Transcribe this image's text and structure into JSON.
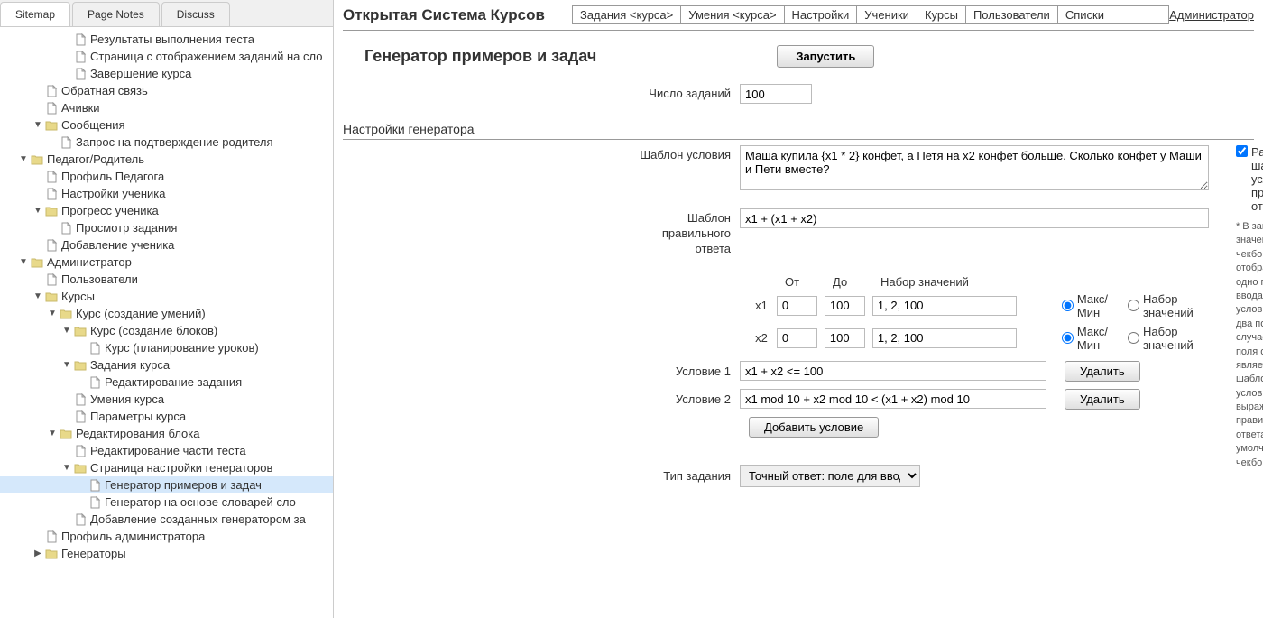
{
  "tabs": {
    "sitemap": "Sitemap",
    "pagenotes": "Page Notes",
    "discuss": "Discuss"
  },
  "tree": {
    "n0": "Результаты выполнения теста",
    "n1": "Страница с отображением заданий на сло",
    "n2": "Завершение курса",
    "n3": "Обратная связь",
    "n4": "Ачивки",
    "n5": "Сообщения",
    "n6": "Запрос на подтверждение родителя",
    "n7": "Педагог/Родитель",
    "n8": "Профиль Педагога",
    "n9": "Настройки ученика",
    "n10": "Прогресс ученика",
    "n11": "Просмотр задания",
    "n12": "Добавление ученика",
    "n13": "Администратор",
    "n14": "Пользователи",
    "n15": "Курсы",
    "n16": "Курс (создание умений)",
    "n17": "Курс (создание блоков)",
    "n18": "Курс (планирование уроков)",
    "n19": "Задания курса",
    "n20": "Редактирование задания",
    "n21": "Умения курса",
    "n22": "Параметры курса",
    "n23": "Редактирования блока",
    "n24": "Редактирование части теста",
    "n25": "Страница настройки генераторов",
    "n26": "Генератор примеров и задач",
    "n27": "Генератор на основе словарей сло",
    "n28": "Добавление созданных генератором за",
    "n29": "Профиль администратора",
    "n30": "Генераторы"
  },
  "header": {
    "app_title": "Открытая Система Курсов",
    "links": [
      "Задания <курса>",
      "Умения <курса>",
      "Настройки",
      "Ученики",
      "Курсы",
      "Пользователи",
      "Списки"
    ],
    "admin": "Администратор"
  },
  "page": {
    "title": "Генератор примеров и задач",
    "run": "Запустить",
    "count_label": "Число заданий",
    "count_value": "100",
    "gen_settings": "Настройки генератора",
    "template_label": "Шаблон условия",
    "template_value": "Маша купила {x1 * 2} конфет, а Петя на x2 конфет больше. Сколько конфет у Маши и Пети вместе?",
    "answer_label": "Шаблон правильного ответа",
    "answer_value": "x1 + (x1 + x2)",
    "separate_check": "Раздельные шаблоны условия и правильного ответа",
    "hint": "* В заивимости от значения чекбокса отображать либо одно поля для ввода шаблона условия. Либо два поля. В случае одного поля оно является шаблоном условия и выражением для правильного ответа. По умолчанию чекбокс сброшен.",
    "col_from": "От",
    "col_to": "До",
    "col_set": "Набор значений",
    "x1": "x1",
    "x2": "x2",
    "x1_from": "0",
    "x1_to": "100",
    "x1_set": "1, 2, 100",
    "x2_from": "0",
    "x2_to": "100",
    "x2_set": "1, 2, 100",
    "radio_minmax": "Макс/Мин",
    "radio_set": "Набор значений",
    "cond1_label": "Условие 1",
    "cond1_value": "x1 + x2 <= 100",
    "cond2_label": "Условие 2",
    "cond2_value": "x1 mod 10 + x2 mod 10 < (x1 + x2) mod 10",
    "delete": "Удалить",
    "add_cond": "Добавить условие",
    "type_label": "Тип задания",
    "type_value": "Точный ответ: поле для ввода"
  }
}
